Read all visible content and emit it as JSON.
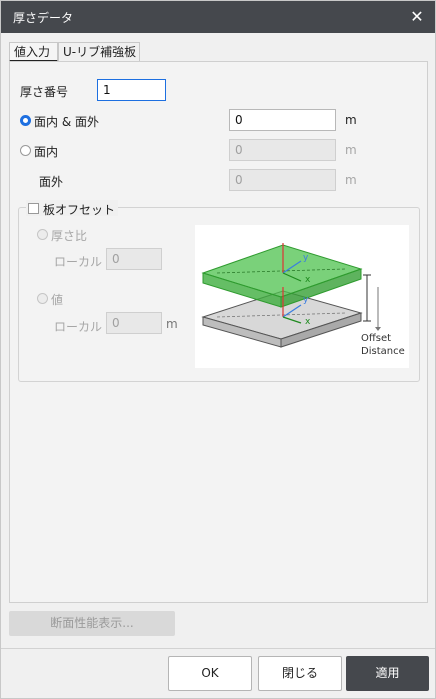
{
  "window": {
    "title": "厚さデータ",
    "close_glyph": "✕"
  },
  "tabs": [
    {
      "label": "値入力"
    },
    {
      "label": "U-リブ補強板"
    }
  ],
  "form": {
    "thickness_no_label": "厚さ番号",
    "thickness_no_value": "1",
    "in_out_plane_label": "面内 & 面外",
    "in_out_plane_value": "0",
    "in_plane_label": "面内",
    "in_plane_value": "0",
    "out_plane_label": "面外",
    "out_plane_value": "0",
    "unit_m": "m"
  },
  "offset": {
    "checkbox_label": "板オフセット",
    "ratio_label": "厚さ比",
    "ratio_local_label": "ローカル",
    "ratio_local_value": "0",
    "value_label": "値",
    "value_local_label": "ローカル",
    "value_local_value": "0",
    "unit_m": "m",
    "illus_offset": "Offset",
    "illus_distance": "Distance",
    "illus_x": "x",
    "illus_y": "y"
  },
  "buttons": {
    "section_props": "断面性能表示...",
    "ok": "OK",
    "close": "閉じる",
    "apply": "適用"
  }
}
